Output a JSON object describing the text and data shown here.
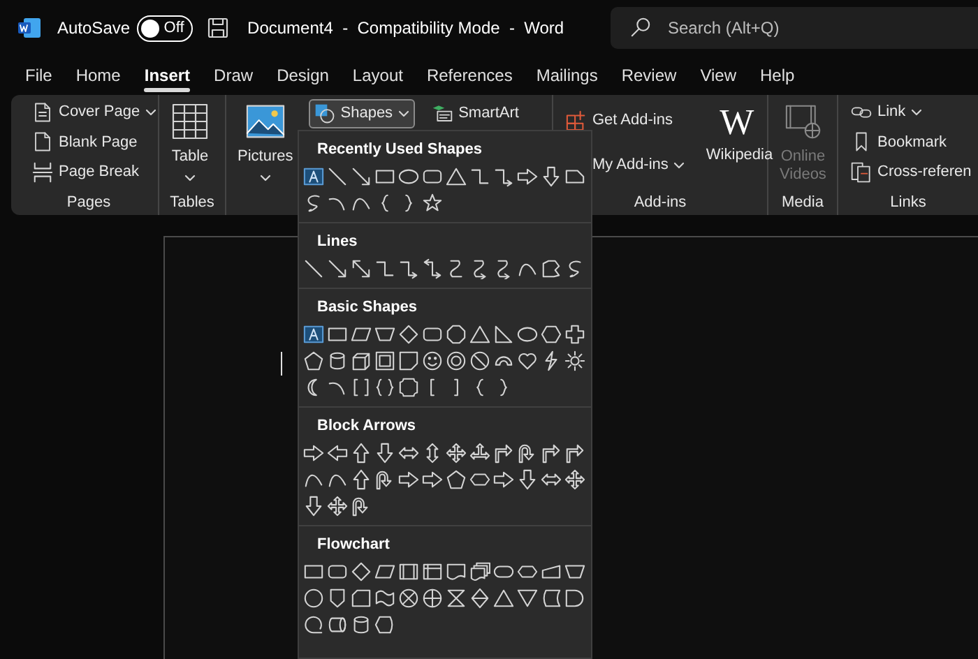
{
  "title_bar": {
    "autosave": {
      "label": "AutoSave",
      "on": false,
      "state": "Off"
    },
    "document_title": "Document4  -  Compatibility Mode  -  Word",
    "search": {
      "placeholder": "Search (Alt+Q)"
    }
  },
  "menu_tabs": [
    {
      "label": "File",
      "selected": false
    },
    {
      "label": "Home",
      "selected": false
    },
    {
      "label": "Insert",
      "selected": true
    },
    {
      "label": "Draw",
      "selected": false
    },
    {
      "label": "Design",
      "selected": false
    },
    {
      "label": "Layout",
      "selected": false
    },
    {
      "label": "References",
      "selected": false
    },
    {
      "label": "Mailings",
      "selected": false
    },
    {
      "label": "Review",
      "selected": false
    },
    {
      "label": "View",
      "selected": false
    },
    {
      "label": "Help",
      "selected": false
    }
  ],
  "ribbon": {
    "groups": [
      {
        "label": "Pages",
        "columns": [
          [
            {
              "kind": "small",
              "label": "Cover Page",
              "dropdown": true,
              "expanded": false,
              "disabled": false
            },
            {
              "kind": "small",
              "label": "Blank Page",
              "dropdown": false,
              "expanded": false,
              "disabled": false
            },
            {
              "kind": "small",
              "label": "Page Break",
              "dropdown": false,
              "expanded": false,
              "disabled": false
            }
          ]
        ]
      },
      {
        "label": "Tables",
        "columns": [
          [
            {
              "kind": "large",
              "label": "Table",
              "dropdown": true,
              "expanded": false,
              "disabled": false
            }
          ]
        ]
      },
      {
        "columns": [
          [
            {
              "kind": "large",
              "label": "Pictures",
              "dropdown": true,
              "expanded": false,
              "disabled": false
            }
          ],
          [
            {
              "kind": "small",
              "label": "Shapes",
              "dropdown": true,
              "expanded": true,
              "disabled": false
            }
          ],
          [
            {
              "kind": "small",
              "label": "SmartArt",
              "dropdown": false,
              "expanded": false,
              "disabled": false
            }
          ]
        ]
      },
      {
        "label": "Add-ins",
        "columns": [
          [
            {
              "kind": "small",
              "label": "Get Add-ins",
              "dropdown": false,
              "expanded": false,
              "disabled": false
            },
            {
              "kind": "small",
              "label": "My Add-ins",
              "dropdown": true,
              "expanded": false,
              "disabled": false
            }
          ],
          [
            {
              "kind": "large",
              "label": "Wikipedia",
              "icon_text": "W",
              "dropdown": false,
              "expanded": false,
              "disabled": false
            }
          ]
        ]
      },
      {
        "label": "Media",
        "columns": [
          [
            {
              "kind": "large",
              "label": "Online Videos",
              "dropdown": false,
              "expanded": false,
              "disabled": true
            }
          ]
        ]
      },
      {
        "label": "Links",
        "columns": [
          [
            {
              "kind": "small",
              "label": "Link",
              "dropdown": true,
              "expanded": false,
              "disabled": false
            },
            {
              "kind": "small",
              "label": "Bookmark",
              "dropdown": false,
              "expanded": false,
              "disabled": false
            },
            {
              "kind": "small",
              "label": "Cross-referen",
              "dropdown": false,
              "expanded": false,
              "disabled": false
            }
          ]
        ]
      }
    ]
  },
  "shapes_menu": {
    "sections": [
      {
        "title": "Recently Used Shapes"
      },
      {
        "title": "Lines"
      },
      {
        "title": "Basic Shapes"
      },
      {
        "title": "Block Arrows"
      },
      {
        "title": "Flowchart"
      }
    ]
  }
}
